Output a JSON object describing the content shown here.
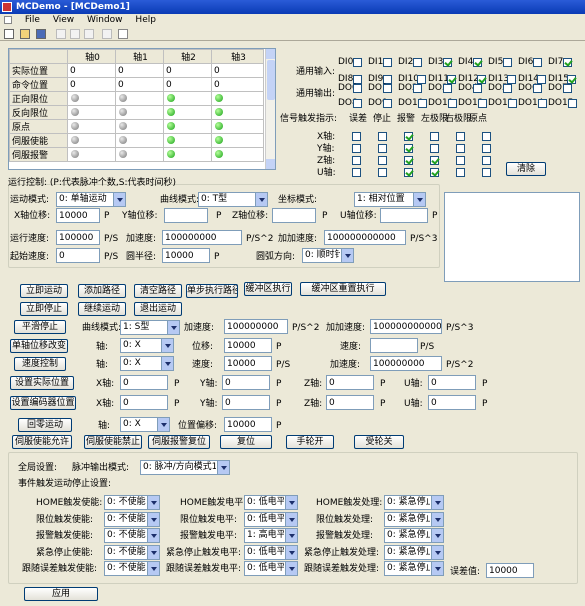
{
  "window": {
    "title": "MCDemo - [MCDemo1]"
  },
  "menu": [
    "File",
    "View",
    "Window",
    "Help"
  ],
  "grid": {
    "headers": [
      "",
      "轴0",
      "轴1",
      "轴2",
      "轴3"
    ],
    "rows": [
      {
        "label": "实际位置",
        "values": [
          "0",
          "0",
          "0",
          "0"
        ]
      },
      {
        "label": "命令位置",
        "values": [
          "0",
          "0",
          "0",
          "0"
        ]
      },
      {
        "label": "正向限位",
        "leds": [
          "gray",
          "gray",
          "green",
          "green"
        ]
      },
      {
        "label": "反向限位",
        "leds": [
          "gray",
          "gray",
          "green",
          "green"
        ]
      },
      {
        "label": "原点",
        "leds": [
          "gray",
          "gray",
          "green",
          "green"
        ]
      },
      {
        "label": "伺服使能",
        "leds": [
          "gray",
          "gray",
          "green",
          "green"
        ]
      },
      {
        "label": "伺服报警",
        "leds": [
          "gray",
          "gray",
          "green",
          "green"
        ]
      }
    ]
  },
  "io": {
    "input_label": "通用输入:",
    "output_label": "通用输出:",
    "inputs": [
      {
        "name": "DI0",
        "on": false
      },
      {
        "name": "DI1",
        "on": false
      },
      {
        "name": "DI2",
        "on": false
      },
      {
        "name": "DI3",
        "on": true
      },
      {
        "name": "DI4",
        "on": true
      },
      {
        "name": "DI5",
        "on": false
      },
      {
        "name": "DI6",
        "on": false
      },
      {
        "name": "DI7",
        "on": true
      },
      {
        "name": "DI8",
        "on": false
      },
      {
        "name": "DI9",
        "on": false
      },
      {
        "name": "DI10",
        "on": false
      },
      {
        "name": "DI11",
        "on": true
      },
      {
        "name": "DI12",
        "on": true
      },
      {
        "name": "DI13",
        "on": false
      },
      {
        "name": "DI14",
        "on": false
      },
      {
        "name": "DI15",
        "on": true
      }
    ],
    "outputs": [
      "DO0",
      "DO1",
      "DO2",
      "DO3",
      "DO4",
      "DO5",
      "DO6",
      "DO7",
      "DO8",
      "DO9",
      "DO10",
      "DO11",
      "DO12",
      "DO13",
      "DO14",
      "DO15"
    ]
  },
  "signals": {
    "title": "信号触发指示:",
    "cols": [
      "误差",
      "停止",
      "报警",
      "左极限",
      "右极限",
      "原点"
    ],
    "rows": [
      {
        "axis": "X轴:",
        "states": [
          false,
          false,
          true,
          false,
          false,
          false
        ]
      },
      {
        "axis": "Y轴:",
        "states": [
          false,
          false,
          true,
          false,
          false,
          false
        ]
      },
      {
        "axis": "Z轴:",
        "states": [
          false,
          false,
          true,
          true,
          false,
          false
        ]
      },
      {
        "axis": "U轴:",
        "states": [
          false,
          false,
          true,
          true,
          false,
          false
        ]
      }
    ],
    "clear_label": "清除"
  },
  "run": {
    "title": "运行控制: (P:代表脉冲个数,S:代表时间秒)",
    "mode_label": "运动模式:",
    "mode_value": "0: 单轴运动",
    "curve_label": "曲线模式:",
    "curve_value": "0: T型",
    "coord_label": "坐标模式:",
    "coord_value": "1: 相对位置",
    "xpos_label": "X轴位移:",
    "xpos_value": "10000",
    "ypos_label": "Y轴位移:",
    "ypos_value": "",
    "zpos_label": "Z轴位移:",
    "zpos_value": "",
    "upos_label": "U轴位移:",
    "upos_value": "",
    "p": "P",
    "speed_label": "运行速度:",
    "speed_value": "100000",
    "speed_unit": "P/S",
    "acc_label": "加速度:",
    "acc_value": "100000000",
    "acc_unit": "P/S^2",
    "jerk_label": "加加速度:",
    "jerk_value": "100000000000",
    "jerk_unit": "P/S^3",
    "start_label": "起始速度:",
    "start_value": "0",
    "start_unit": "P/S",
    "radius_label": "圆半径:",
    "radius_value": "10000",
    "radius_unit": "P",
    "dir_label": "圆弧方向:",
    "dir_value": "0: 顺时针"
  },
  "buttons": {
    "start": "立即运动",
    "add_path": "添加路径",
    "clear_path": "清空路径",
    "step_path": "单步执行路径",
    "buffer_exec": "缓冲区执行",
    "buffer_reset": "缓冲区重置执行",
    "stop": "立即停止",
    "continue": "继续运动",
    "exit": "退出运动"
  },
  "smooth": {
    "btn": "平滑停止",
    "curve_label": "曲线模式:",
    "curve_value": "1: S型",
    "acc_label": "加速度:",
    "acc_value": "100000000",
    "acc_unit": "P/S^2",
    "jerk_label": "加加速度:",
    "jerk_value": "100000000000",
    "jerk_unit": "P/S^3"
  },
  "single": {
    "btn": "单轴位移改变",
    "axis_label": "轴:",
    "axis_value": "0: X",
    "pos_label": "位移:",
    "pos_value": "10000",
    "p": "P",
    "speed_label": "速度:",
    "speed_value": "",
    "speed_unit": "P/S"
  },
  "speedctl": {
    "btn": "速度控制",
    "axis_label": "轴:",
    "axis_value": "0: X",
    "speed_label": "速度:",
    "speed_value": "10000",
    "speed_unit": "P/S",
    "acc_label": "加速度:",
    "acc_value": "100000000",
    "acc_unit": "P/S^2"
  },
  "setpos": {
    "btn": "设置实际位置",
    "x": "X轴:",
    "xv": "0",
    "y": "Y轴:",
    "yv": "0",
    "z": "Z轴:",
    "zv": "0",
    "u": "U轴:",
    "uv": "0",
    "p": "P"
  },
  "setenc": {
    "btn": "设置编码器位置",
    "x": "X轴:",
    "xv": "0",
    "y": "Y轴:",
    "yv": "0",
    "z": "Z轴:",
    "zv": "0",
    "u": "U轴:",
    "uv": "0",
    "p": "P"
  },
  "home": {
    "btn": "回零运动",
    "axis_label": "轴:",
    "axis_value": "0: X",
    "offset_label": "位置偏移:",
    "offset_value": "10000",
    "p": "P"
  },
  "bottom_buttons": [
    "伺服使能允许",
    "伺服使能禁止",
    "伺服报警复位",
    "复位",
    "手轮开",
    "受轮关"
  ],
  "global": {
    "title": "全局设置:",
    "pulse_label": "脉冲输出模式:",
    "pulse_value": "0: 脉冲/方向模式1",
    "event_title": "事件触发运动停止设置:",
    "rows": [
      {
        "a": "HOME触发使能:",
        "av": "0: 不使能",
        "b": "HOME触发电平:",
        "bv": "0: 低电平",
        "c": "HOME触发处理:",
        "cv": "0: 紧急停止"
      },
      {
        "a": "限位触发使能:",
        "av": "0: 不使能",
        "b": "限位触发电平:",
        "bv": "0: 低电平",
        "c": "限位触发处理:",
        "cv": "0: 紧急停止"
      },
      {
        "a": "报警触发使能:",
        "av": "0: 不使能",
        "b": "报警触发电平:",
        "bv": "1: 高电平",
        "c": "报警触发处理:",
        "cv": "0: 紧急停止"
      },
      {
        "a": "紧急停止使能:",
        "av": "0: 不使能",
        "b": "紧急停止触发电平:",
        "bv": "0: 低电平",
        "c": "紧急停止触发处理:",
        "cv": "0: 紧急停止"
      },
      {
        "a": "跟随误差触发使能:",
        "av": "0: 不使能",
        "b": "跟随误差触发电平:",
        "bv": "0: 低电平",
        "c": "跟随误差触发处理:",
        "cv": "0: 紧急停止"
      }
    ],
    "err_label": "误差值:",
    "err_value": "10000",
    "apply": "应用"
  }
}
